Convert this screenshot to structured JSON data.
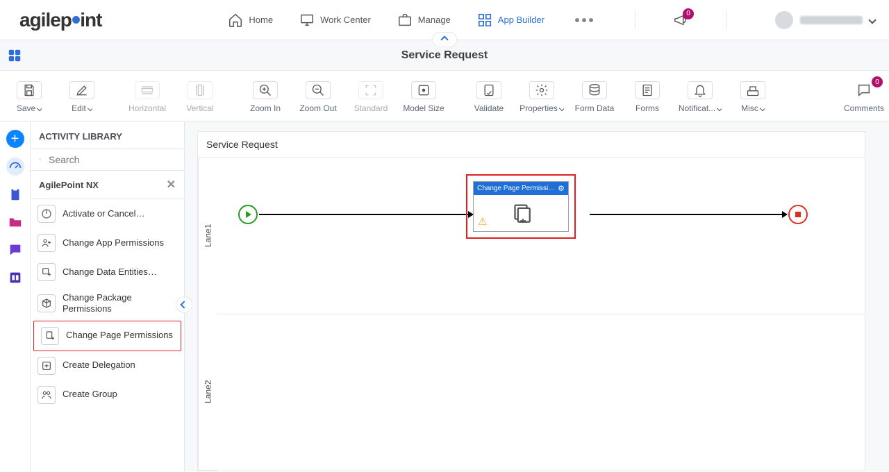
{
  "logo": {
    "pre": "agilep",
    "post": "int"
  },
  "nav": {
    "home": "Home",
    "work_center": "Work Center",
    "manage": "Manage",
    "app_builder": "App Builder"
  },
  "notif_badge": "0",
  "subheader": {
    "title": "Service Request"
  },
  "toolbar": {
    "save": "Save",
    "edit": "Edit",
    "horizontal": "Horizontal",
    "vertical": "Vertical",
    "zoom_in": "Zoom In",
    "zoom_out": "Zoom Out",
    "standard": "Standard",
    "model": "Model Size",
    "validate": "Validate",
    "properties": "Properties",
    "form_data": "Form Data",
    "forms": "Forms",
    "notifications": "Notificat...",
    "misc": "Misc",
    "comments": "Comments"
  },
  "comments_badge": "0",
  "library": {
    "heading": "ACTIVITY LIBRARY",
    "search_placeholder": "Search",
    "group": "AgilePoint NX",
    "items": [
      "Activate or Cancel…",
      "Change App Permissions",
      "Change Data Entities…",
      "Change Package Permissions",
      "Change Page Permissions",
      "Create Delegation",
      "Create Group"
    ]
  },
  "canvas": {
    "title": "Service Request",
    "lanes": [
      "Lane1",
      "Lane2"
    ],
    "activity_label": "Change Page Permissi..."
  }
}
